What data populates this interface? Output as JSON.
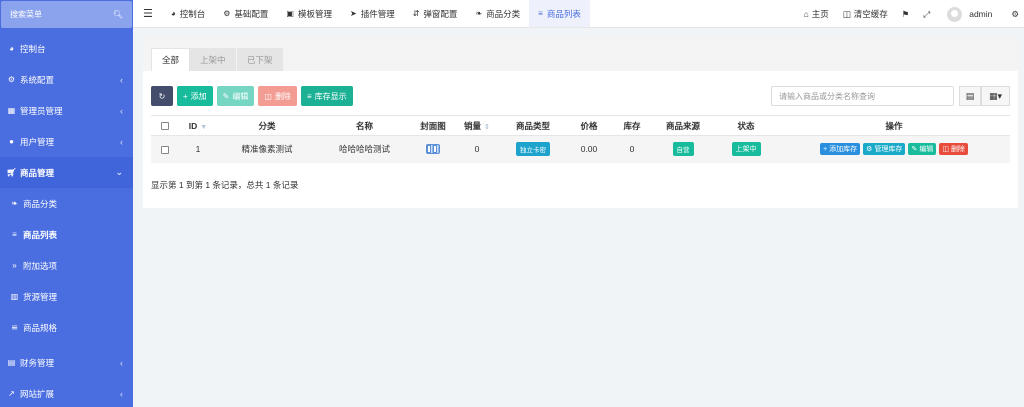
{
  "sidebar": {
    "search_label": "搜索菜单",
    "items": [
      {
        "label": "控制台",
        "icon": "dashboard-icon"
      },
      {
        "label": "系统配置",
        "icon": "cogs-icon"
      },
      {
        "label": "管理员管理",
        "icon": "windows-icon"
      },
      {
        "label": "用户管理",
        "icon": "user-icon"
      },
      {
        "label": "商品管理",
        "icon": "cart-icon"
      },
      {
        "label": "商品分类",
        "icon": "leaf-icon"
      },
      {
        "label": "商品列表",
        "icon": "list-icon"
      },
      {
        "label": "附加选项",
        "icon": "angle-double-right-icon"
      },
      {
        "label": "货源管理",
        "icon": "sitemap-icon"
      },
      {
        "label": "商品规格",
        "icon": "sliders-icon"
      },
      {
        "label": "财务管理",
        "icon": "money-icon"
      },
      {
        "label": "网站扩展",
        "icon": "external-link-icon"
      }
    ]
  },
  "topbar": {
    "menu": [
      {
        "label": "控制台",
        "icon": "dashboard-icon"
      },
      {
        "label": "基础配置",
        "icon": "gear-icon"
      },
      {
        "label": "模板管理",
        "icon": "monitor-icon"
      },
      {
        "label": "插件管理",
        "icon": "rocket-icon"
      },
      {
        "label": "弹窗配置",
        "icon": "sort-icon"
      },
      {
        "label": "商品分类",
        "icon": "leaf-icon"
      },
      {
        "label": "商品列表",
        "icon": "list-icon"
      }
    ],
    "right": {
      "home": "主页",
      "clear_cache": "清空缓存",
      "user": "admin"
    }
  },
  "tabs": [
    "全部",
    "上架中",
    "已下架"
  ],
  "toolbar": {
    "add": "添加",
    "edit": "编辑",
    "delete": "删除",
    "stock": "库存显示"
  },
  "search": {
    "placeholder": "请输入商品或分类名称查询"
  },
  "table": {
    "headers": [
      "ID",
      "分类",
      "名称",
      "封面图",
      "销量",
      "商品类型",
      "价格",
      "库存",
      "商品来源",
      "状态",
      "操作"
    ],
    "rows": [
      {
        "id": "1",
        "category": "精准像素测试",
        "name": "哈哈哈哈测试",
        "sales": "0",
        "type": "独立卡密",
        "price": "0.00",
        "stock": "0",
        "source": "自营",
        "status": "上架中",
        "ops": [
          "添加库存",
          "管理库存",
          "编辑",
          "删除"
        ]
      }
    ]
  },
  "summary": "显示第 1 到第 1 条记录，总共 1 条记录",
  "colors": {
    "sidebar": "#4a6de0",
    "primary_green": "#18bc9c",
    "danger": "#e74c3c",
    "info": "#1ea3cc"
  }
}
